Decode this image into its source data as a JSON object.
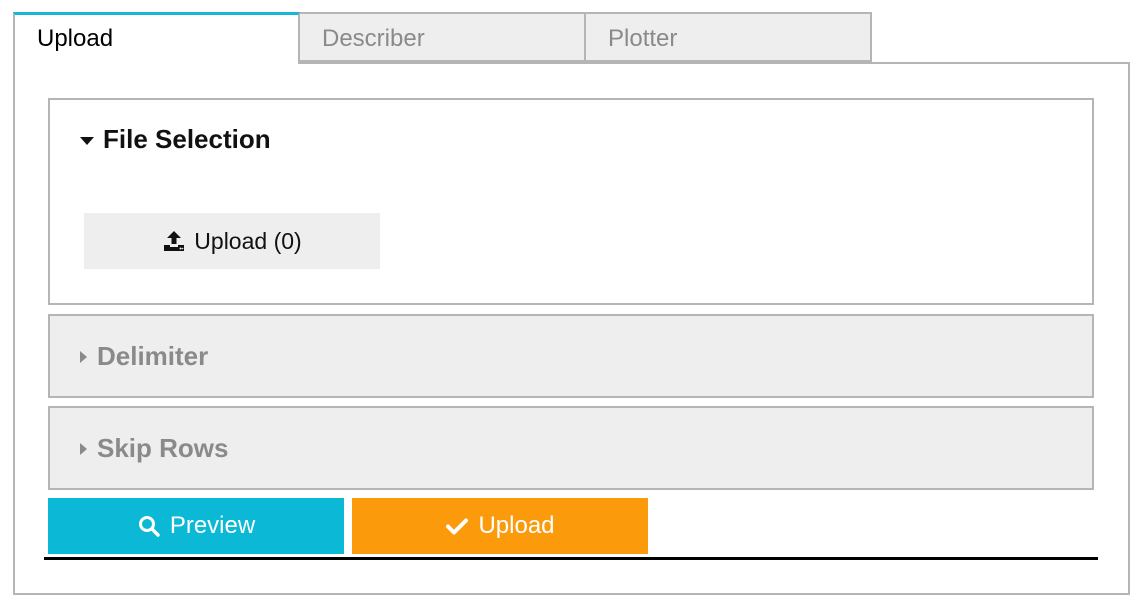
{
  "tabs": [
    {
      "label": "Upload",
      "active": true
    },
    {
      "label": "Describer",
      "active": false
    },
    {
      "label": "Plotter",
      "active": false
    }
  ],
  "sections": {
    "file_selection": {
      "title": "File Selection",
      "expanded": true,
      "upload_button_label": "Upload (0)",
      "upload_icon": "upload-icon"
    },
    "delimiter": {
      "title": "Delimiter",
      "expanded": false
    },
    "skip_rows": {
      "title": "Skip Rows",
      "expanded": false
    }
  },
  "actions": {
    "preview_label": "Preview",
    "preview_icon": "search-icon",
    "upload_label": "Upload",
    "upload_icon": "checkmark-icon"
  },
  "colors": {
    "active_tab_accent": "#1ab6d3",
    "preview_button": "#0bb8d6",
    "upload_button": "#fb9b0b",
    "inactive_bg": "#eeeeee",
    "border": "#b5b5b5"
  }
}
